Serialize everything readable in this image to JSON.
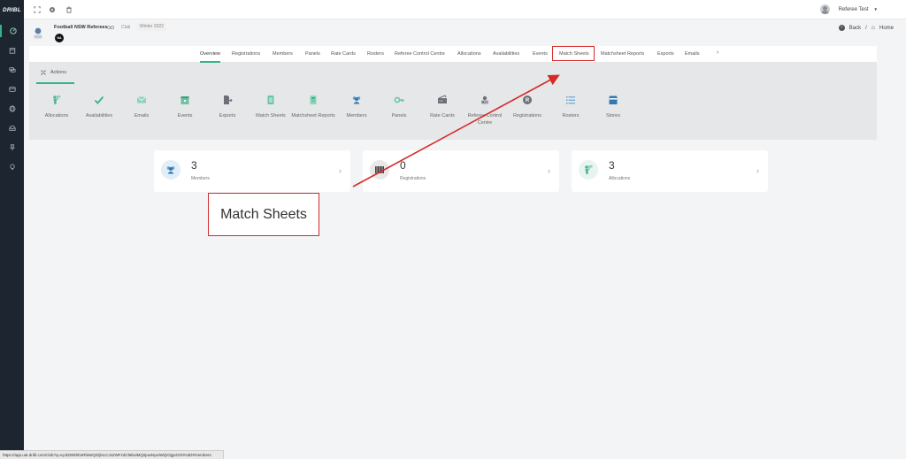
{
  "sidebar": {
    "logo": "DRIBL",
    "items": [
      "dashboard-icon",
      "calendar-icon",
      "chat-icon",
      "ledger-icon",
      "globe-icon",
      "inbox-icon",
      "pin-icon",
      "bulb-icon"
    ]
  },
  "topbar": {
    "user_name": "Referee Test"
  },
  "org": {
    "name": "Football NSW Referees",
    "type": "Club",
    "season": "Winter 2022",
    "avatar_text": "NA"
  },
  "breadcrumb": {
    "back": "Back",
    "separator": "/",
    "home": "Home"
  },
  "tabs": [
    "Overview",
    "Registrations",
    "Members",
    "Panels",
    "Rate Cards",
    "Rosters",
    "Referee Control Centre",
    "Allocations",
    "Availabilities",
    "Events",
    "Match Sheets",
    "Matchsheet Reports",
    "Exports",
    "Emails"
  ],
  "actions": {
    "title": "Actions",
    "items": [
      {
        "label": "Allocations",
        "icon": "referee-flag-icon"
      },
      {
        "label": "Availabilities",
        "icon": "check-icon"
      },
      {
        "label": "Emails",
        "icon": "envelope-icon"
      },
      {
        "label": "Events",
        "icon": "calendar-event-icon"
      },
      {
        "label": "Exports",
        "icon": "export-icon"
      },
      {
        "label": "Match Sheets",
        "icon": "match-sheet-icon"
      },
      {
        "label": "Matchsheet Reports",
        "icon": "report-icon"
      },
      {
        "label": "Members",
        "icon": "members-icon"
      },
      {
        "label": "Panels",
        "icon": "key-icon"
      },
      {
        "label": "Rate Cards",
        "icon": "rate-card-icon"
      },
      {
        "label": "Referee Control Centre",
        "icon": "control-centre-icon"
      },
      {
        "label": "Registrations",
        "icon": "registration-r-icon"
      },
      {
        "label": "Rosters",
        "icon": "list-icon"
      },
      {
        "label": "Stores",
        "icon": "store-icon"
      }
    ]
  },
  "cards": [
    {
      "count": "3",
      "label": "Members",
      "icon": "members-icon"
    },
    {
      "count": "0",
      "label": "Registrations",
      "icon": "registrations-icon"
    },
    {
      "count": "3",
      "label": "Allocations",
      "icon": "referee-flag-icon"
    }
  ],
  "callout": {
    "text": "Match Sheets"
  },
  "statusbar": {
    "url": "https://app.uat.dribl.com/club?q=eyJlZW5hbnRfaWQiOjlsLCJsZWFzdCl6IlwiMQiIjowNywiWQiOjgxOX0%3D#members"
  },
  "colors": {
    "accent": "#37b38a",
    "highlight": "#d62a2a",
    "sidebar": "#1d2530"
  }
}
